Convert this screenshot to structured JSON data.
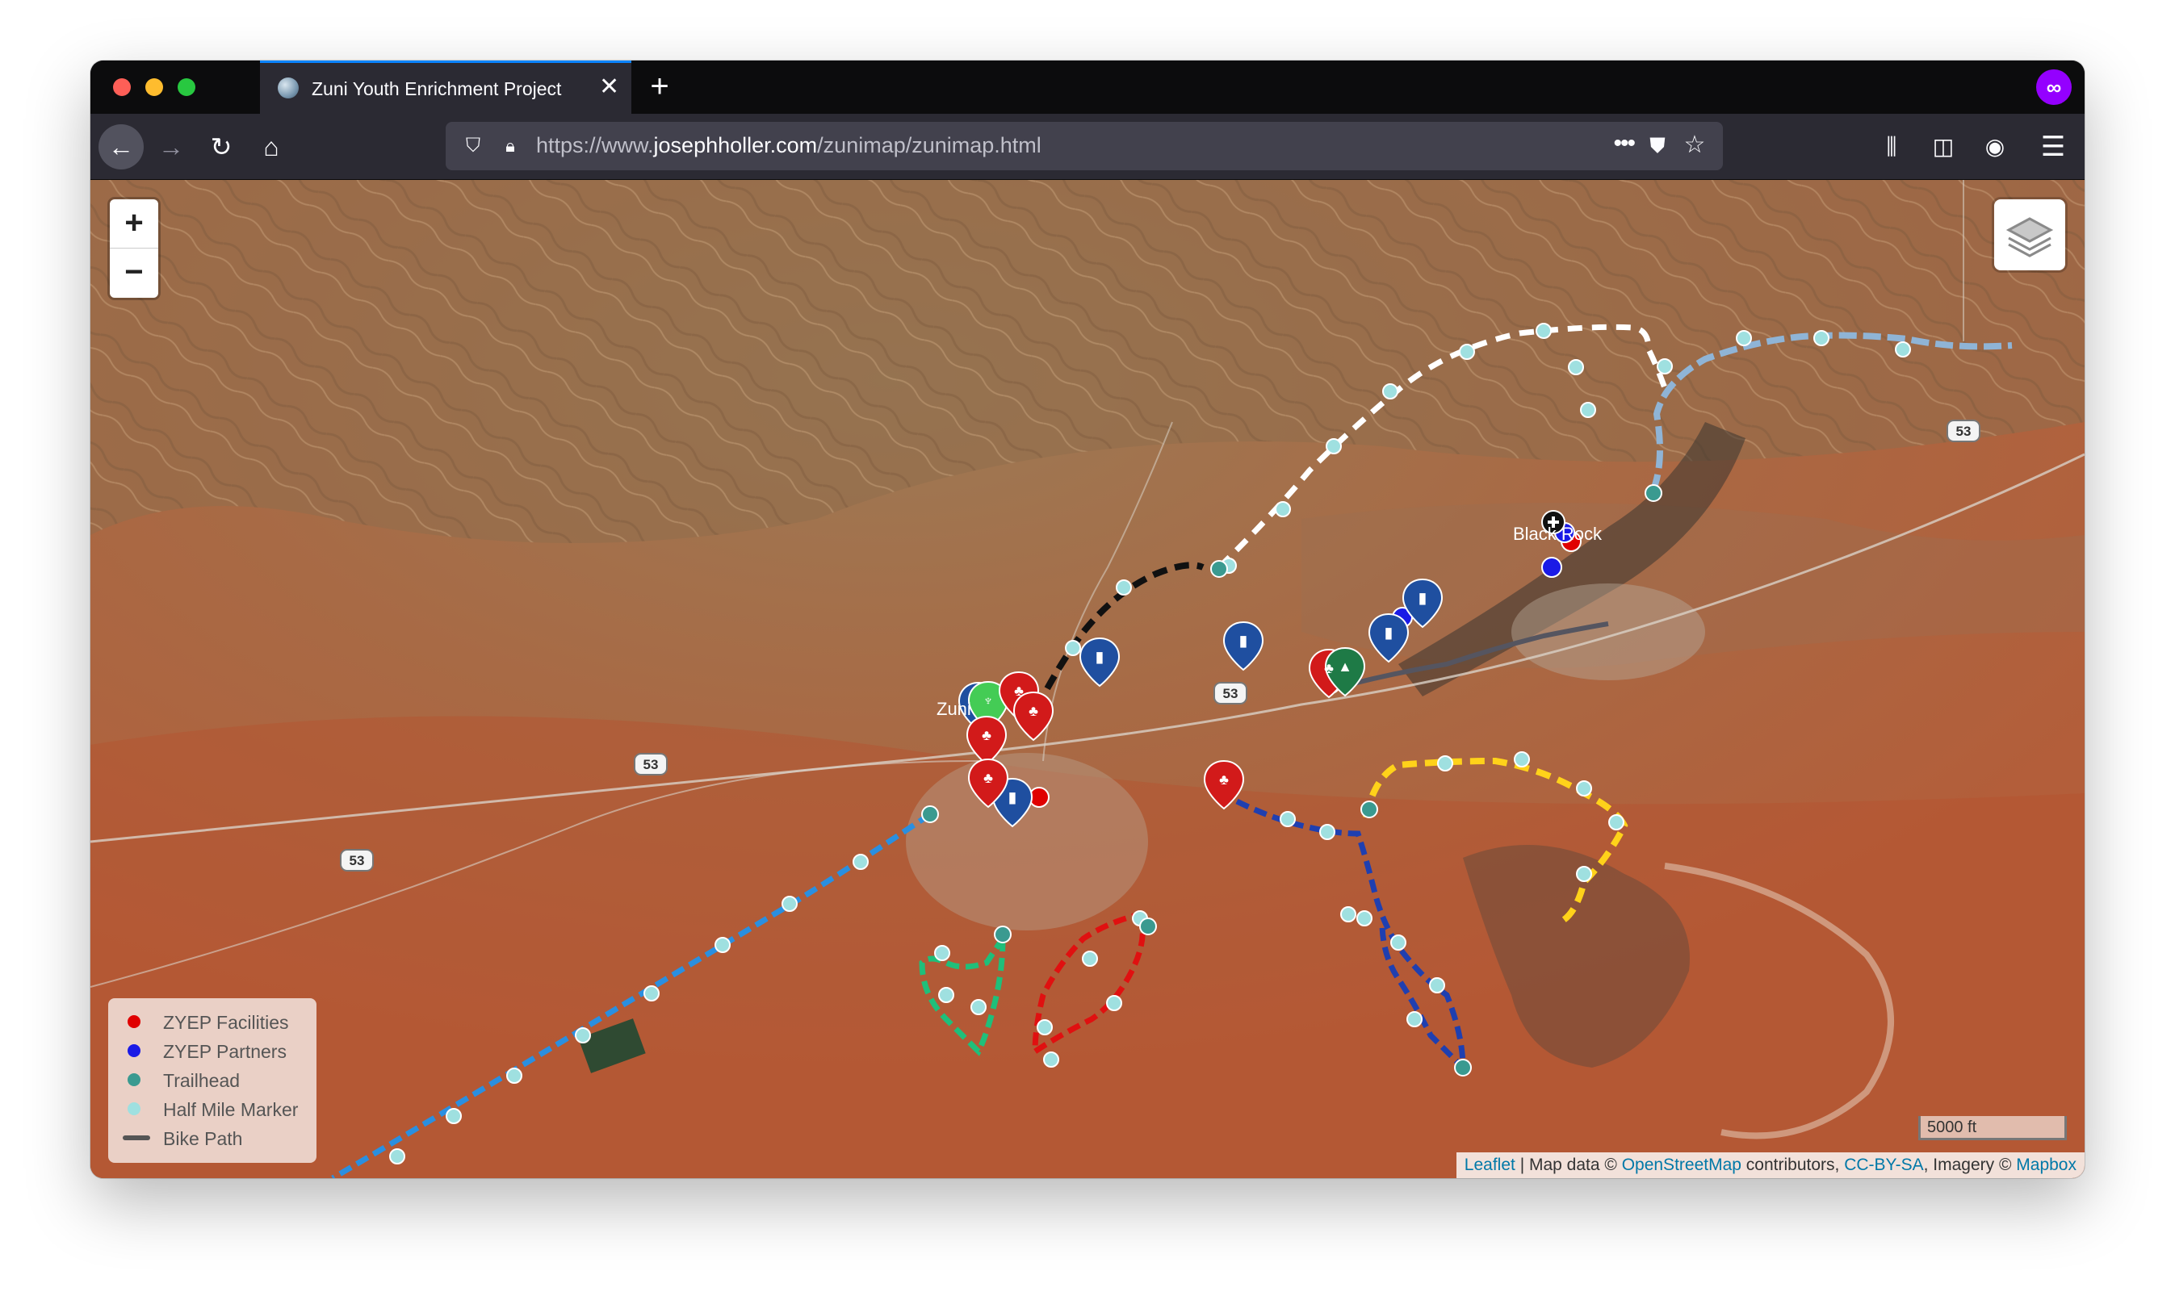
{
  "browser": {
    "tab_title": "Zuni Youth Enrichment Project",
    "url_prefix": "https://www.",
    "url_host": "josephholler.com",
    "url_path": "/zunimap/zunimap.html"
  },
  "map": {
    "zoom_in_label": "+",
    "zoom_out_label": "−",
    "place_labels": {
      "zuni": "Zuni",
      "black_rock": "Black Rock"
    },
    "highway_shields": [
      "53",
      "53",
      "53",
      "53"
    ],
    "legend": [
      {
        "label": "ZYEP Facilities",
        "color": "#e00000"
      },
      {
        "label": "ZYEP Partners",
        "color": "#1a1ae6"
      },
      {
        "label": "Trailhead",
        "color": "#3a9a90"
      },
      {
        "label": "Half Mile Marker",
        "color": "#9fe0e0"
      },
      {
        "label": "Bike Path",
        "color": "#555555"
      }
    ],
    "scale_label": "5000 ft",
    "attribution": {
      "leaflet": "Leaflet",
      "sep1": " | Map data © ",
      "osm": "OpenStreetMap",
      "sep2": " contributors, ",
      "license": "CC-BY-SA",
      "sep3": ", Imagery © ",
      "mapbox": "Mapbox"
    },
    "trail_colors": {
      "white": "#ffffff",
      "black": "#111111",
      "lightblue": "#8fb4d6",
      "blue": "#2a8fe0",
      "green": "#1fbf7a",
      "red": "#e01010",
      "navy": "#1f3fb0",
      "yellow": "#ffd21a",
      "bike": "#555560"
    }
  }
}
